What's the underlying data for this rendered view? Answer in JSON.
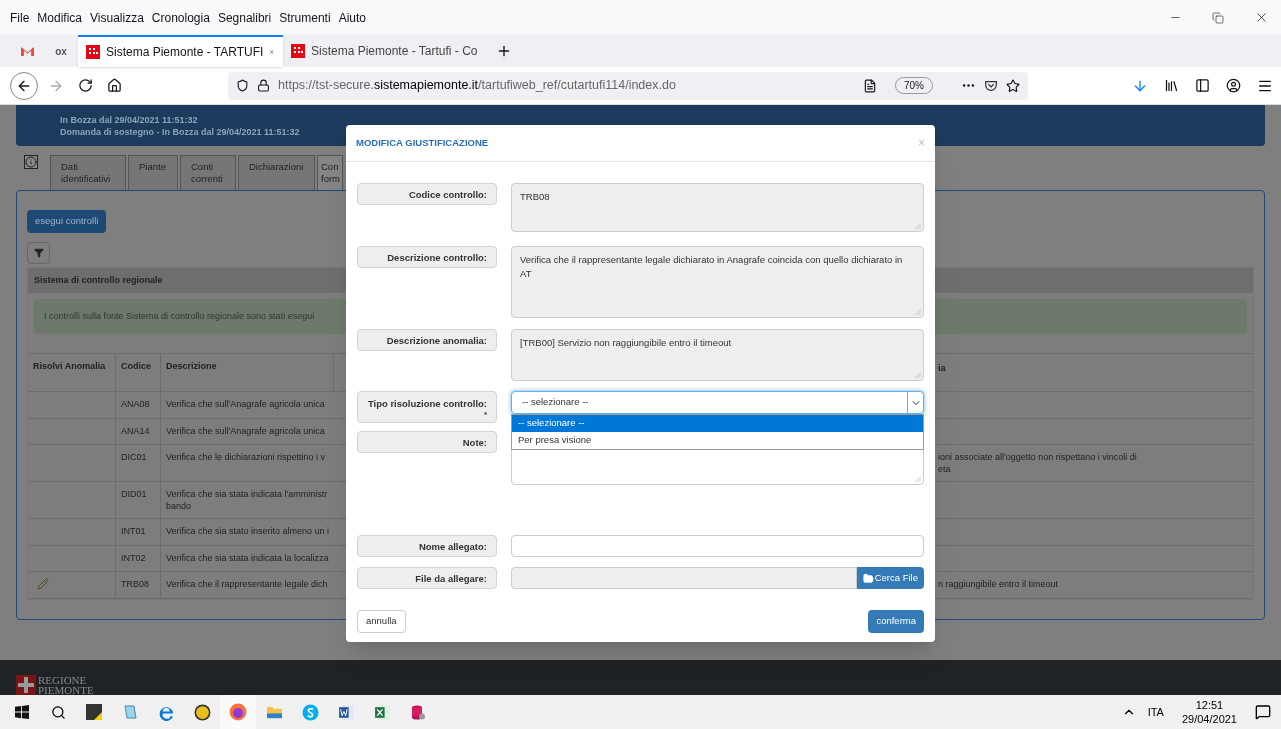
{
  "browser": {
    "menu": [
      "File",
      "Modifica",
      "Visualizza",
      "Cronologia",
      "Segnalibri",
      "Strumenti",
      "Aiuto"
    ],
    "pinned_tabs": [
      {
        "kind": "gmail"
      },
      {
        "kind": "text",
        "label": "ox"
      }
    ],
    "tabs": [
      {
        "title": "Sistema Piemonte - TARTUFI",
        "selected": true
      },
      {
        "title": "Sistema Piemonte - Tartufi - Co",
        "selected": false
      }
    ],
    "url": "https://tst-secure.**sistemapiemonte.it**/tartufiweb_ref/cutartufi114/index.do",
    "zoom": "70%"
  },
  "page": {
    "header_lines": [
      "In Bozza dal 29/04/2021 11:51:32",
      "Domanda di sostegno - In Bozza dal 29/04/2021 11:51:32"
    ],
    "tabs": [
      {
        "label": "Dati identificativi",
        "selected": false
      },
      {
        "label": "Piante",
        "selected": false
      },
      {
        "label": "Conti correnti",
        "selected": false
      },
      {
        "label": "Dichiarazioni",
        "selected": false
      },
      {
        "label": "Con form",
        "selected": true
      }
    ],
    "action_button": "esegui controlli",
    "section_title": "Sistema di controllo regionale",
    "alert": "I controlli sulla fonte Sistema di controllo regionale sono stati esegui",
    "table": {
      "columns": [
        "Risolvi Anomalia",
        "Codice",
        "Descrizione",
        "ia"
      ],
      "rows": [
        {
          "editable": false,
          "code": "ANA08",
          "description": [
            "Verifica che sull'Anagrafe agricola unica"
          ],
          "column_4": []
        },
        {
          "editable": false,
          "code": "ANA14",
          "description": [
            "Verifica che sull'Anagrafe agricola unica"
          ],
          "column_4": []
        },
        {
          "editable": false,
          "code": "DIC01",
          "description": [
            "Verifica che le dichiarazioni rispettino i v"
          ],
          "column_4": [
            "ioni associate all'oggetto non rispettano i vincoli di",
            "eta"
          ]
        },
        {
          "editable": false,
          "code": "DID01",
          "description": [
            "Verifica che sia stata indicata l'amministr",
            "bando"
          ],
          "column_4": []
        },
        {
          "editable": false,
          "code": "INT01",
          "description": [
            "Verifica che sia stato inserito almeno un i"
          ],
          "column_4": []
        },
        {
          "editable": false,
          "code": "INT02",
          "description": [
            "Verifica che sia stata indicata la localizza"
          ],
          "column_4": []
        },
        {
          "editable": true,
          "code": "TRB08",
          "description": [
            "Verifica che il rappresentante legale dich"
          ],
          "column_4": [
            "n raggiungibile entro il timeout"
          ]
        }
      ]
    },
    "footer_logo": [
      "REGIONE",
      "PIEMONTE"
    ]
  },
  "modal": {
    "title": "MODIFICA GIUSTIFICAZIONE",
    "close": "×",
    "fields": [
      {
        "kind": "textarea",
        "label": "Codice controllo:",
        "value": "TRB08",
        "disabled": true
      },
      {
        "kind": "textarea",
        "label": "Descrizione controllo:",
        "value": "Verifica che il rappresentante legale dichiarato in Anagrafe coincida con quello dichiarato in AT",
        "disabled": true
      },
      {
        "kind": "textarea",
        "label": "Descrizione anomalia:",
        "value": "[TRB00] Servizio non raggiungibile entro il timeout",
        "disabled": true
      },
      {
        "kind": "select",
        "label": "Tipo risoluzione controllo:",
        "required_mark": "*",
        "value": "-- selezionare --",
        "expanded": true,
        "options": [
          {
            "label": "-- selezionare --",
            "selected": true
          },
          {
            "label": "Per presa visione",
            "selected": false
          }
        ]
      },
      {
        "kind": "textarea",
        "label": "Note:",
        "disabled": false
      },
      {
        "kind": "input",
        "label": "Nome allegato:",
        "disabled": false
      },
      {
        "kind": "file",
        "label": "File da allegare:",
        "disabled": true,
        "button": "Cerca File"
      }
    ],
    "cancel": "annulla",
    "confirm": "conferma"
  },
  "taskbar": {
    "language": "ITA",
    "time": "12:51",
    "date": "29/04/2021"
  }
}
